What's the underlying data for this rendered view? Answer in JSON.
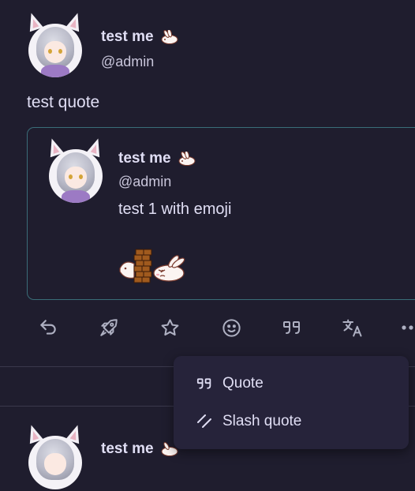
{
  "post": {
    "display_name": "test me",
    "handle": "@admin",
    "text": "test quote"
  },
  "quoted_post": {
    "display_name": "test me",
    "handle": "@admin",
    "text": "test 1 with emoji"
  },
  "next_post": {
    "display_name": "test me"
  },
  "actions": [
    {
      "icon": "reply-icon"
    },
    {
      "icon": "renote-rocket-icon"
    },
    {
      "icon": "star-icon"
    },
    {
      "icon": "emoji-reaction-icon"
    },
    {
      "icon": "quote-icon"
    },
    {
      "icon": "translate-icon"
    },
    {
      "icon": "more-icon"
    }
  ],
  "quote_menu": {
    "items": [
      {
        "label": "Quote",
        "icon": "quote-icon"
      },
      {
        "label": "Slash quote",
        "icon": "slash-icon"
      }
    ]
  },
  "colors": {
    "background": "#1f1d2e",
    "text": "#e0def4",
    "muted_icon": "#aeb0c2",
    "quote_border": "#3a6d78",
    "menu_bg": "#26233a"
  }
}
